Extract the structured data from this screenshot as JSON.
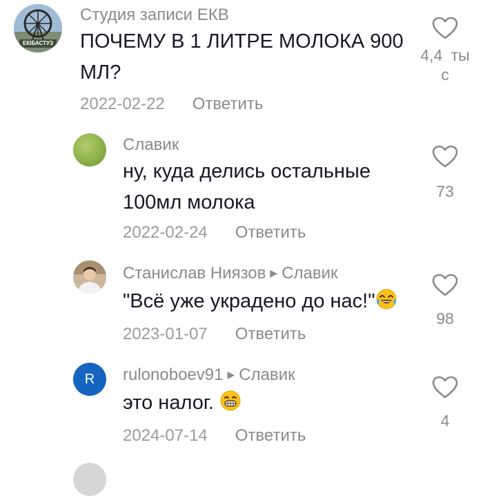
{
  "comments": [
    {
      "author": "Студия записи ЕКВ",
      "avatar_label": "ЕКІБАСТУЗ",
      "text_line1": "ПОЧЕМУ В 1 ЛИТРЕ МОЛОКА 900",
      "text_line2": "МЛ?",
      "date": "2022-02-22",
      "reply_label": "Ответить",
      "likes": "4,4 ты с"
    },
    {
      "author": "Славик",
      "text_line1": "ну, куда делись остальные",
      "text_line2": "100мл молока",
      "date": "2022-02-24",
      "reply_label": "Ответить",
      "likes": "73"
    },
    {
      "author": "Станислав Ниязов",
      "reply_to": "Славик",
      "text": "\"Всё уже украдено до нас!\"",
      "emoji": "laughing-tears-emoji",
      "date": "2023-01-07",
      "reply_label": "Ответить",
      "likes": "98"
    },
    {
      "author": "rulonoboev91",
      "reply_to": "Славик",
      "avatar_letter": "R",
      "text": "это налог.",
      "emoji": "grinning-emoji",
      "date": "2024-07-14",
      "reply_label": "Ответить",
      "likes": "4"
    }
  ],
  "colors": {
    "text": "#161823",
    "muted": "#8a8a8a",
    "avatar_r": "#1565c0",
    "avatar_green": "#8bb24a"
  },
  "icons": [
    "heart-outline-icon",
    "reply-arrow-icon"
  ]
}
